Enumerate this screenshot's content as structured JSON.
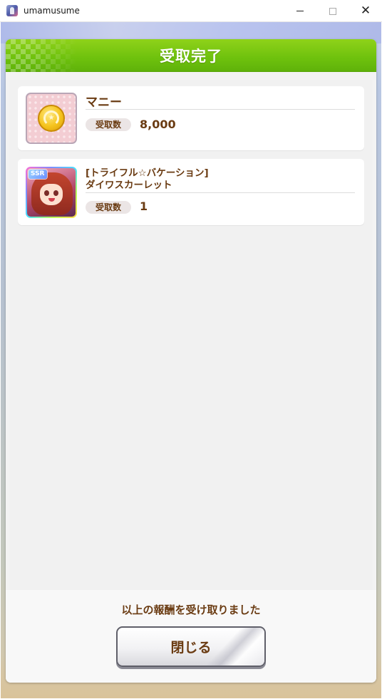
{
  "window": {
    "title": "umamusume",
    "minimize_label": "—",
    "maximize_label": "☐",
    "close_label": "✕"
  },
  "dialog": {
    "title": "受取完了",
    "items": [
      {
        "name": "マニー",
        "qty_label": "受取数",
        "qty": "8,000",
        "icon": "money-coin-icon"
      },
      {
        "name_line1": "[トライフル☆バケーション]",
        "name_line2": "ダイワスカーレット",
        "qty_label": "受取数",
        "qty": "1",
        "badge": "SSR",
        "icon": "support-card-portrait"
      }
    ],
    "footer_message": "以上の報酬を受け取りました",
    "close_button": "閉じる"
  }
}
